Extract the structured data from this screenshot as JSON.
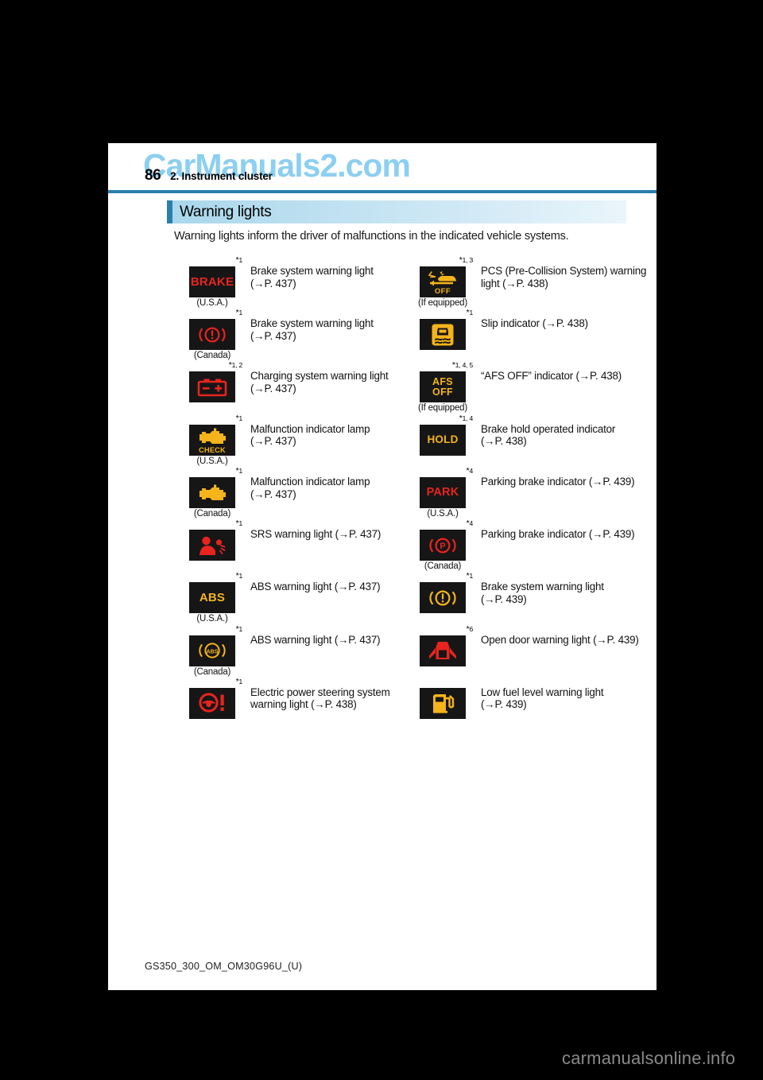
{
  "watermark": "CarManuals2.com",
  "header": {
    "page_number": "86",
    "chapter": "2. Instrument cluster"
  },
  "section": {
    "title": "Warning lights"
  },
  "intro": "Warning lights inform the driver of malfunctions in the indicated vehicle systems.",
  "footer": {
    "doc_code": "GS350_300_OM_OM30G96U_(U)"
  },
  "sitemark": "carmanualsonline.info",
  "colors": {
    "accent_blue": "#2a7fad",
    "title_band": "#a9d7ec",
    "lamp_bg": "#161616",
    "warning_red": "#e8241f",
    "warning_amber": "#f5b41b",
    "watermark_blue": "#79c7ef"
  },
  "rows": [
    {
      "left": {
        "footnote": "*1",
        "icon": "brake-text-lamp-icon",
        "lamp_text": "BRAKE",
        "region": "(U.S.A.)",
        "description": "Brake system warning light",
        "page_ref": "(→P. 437)"
      },
      "right": {
        "footnote": "*1, 3",
        "icon": "pcs-off-lamp-icon",
        "lamp_text": "OFF",
        "region": "(If equipped)",
        "description": "PCS (Pre-Collision System) warning light",
        "page_ref": "(→P. 438)"
      }
    },
    {
      "left": {
        "footnote": "*1",
        "icon": "brake-circle-red-lamp-icon",
        "lamp_text": "",
        "region": "(Canada)",
        "description": "Brake system warning light",
        "page_ref": "(→P. 437)"
      },
      "right": {
        "footnote": "*1",
        "icon": "slip-indicator-lamp-icon",
        "lamp_text": "",
        "region": "",
        "description": "Slip indicator",
        "page_ref": "(→P. 438)"
      }
    },
    {
      "left": {
        "footnote": "*1, 2",
        "icon": "battery-charging-lamp-icon",
        "lamp_text": "",
        "region": "",
        "description": "Charging system warning light",
        "page_ref": "(→P. 437)"
      },
      "right": {
        "footnote": "*1, 4, 5",
        "icon": "afs-off-lamp-icon",
        "lamp_text": "AFS OFF",
        "region": "(If equipped)",
        "description": "“AFS OFF” indicator",
        "page_ref": "(→P. 438)"
      }
    },
    {
      "left": {
        "footnote": "*1",
        "icon": "check-engine-check-lamp-icon",
        "lamp_text": "CHECK",
        "region": "(U.S.A.)",
        "description": "Malfunction indicator lamp",
        "page_ref": "(→P. 437)"
      },
      "right": {
        "footnote": "*1, 4",
        "icon": "brake-hold-lamp-icon",
        "lamp_text": "HOLD",
        "region": "",
        "description": "Brake hold operated indicator",
        "page_ref": "(→P. 438)"
      }
    },
    {
      "left": {
        "footnote": "*1",
        "icon": "check-engine-lamp-icon",
        "lamp_text": "",
        "region": "(Canada)",
        "description": "Malfunction indicator lamp",
        "page_ref": "(→P. 437)"
      },
      "right": {
        "footnote": "*4",
        "icon": "park-text-lamp-icon",
        "lamp_text": "PARK",
        "region": "(U.S.A.)",
        "description": "Parking brake indicator",
        "page_ref": "(→P. 439)"
      }
    },
    {
      "left": {
        "footnote": "*1",
        "icon": "srs-airbag-lamp-icon",
        "lamp_text": "",
        "region": "",
        "description": "SRS warning light",
        "page_ref": "(→P. 437)"
      },
      "right": {
        "footnote": "*4",
        "icon": "parking-brake-p-lamp-icon",
        "lamp_text": "",
        "region": "(Canada)",
        "description": "Parking brake indicator",
        "page_ref": "(→P. 439)"
      }
    },
    {
      "left": {
        "footnote": "*1",
        "icon": "abs-text-lamp-icon",
        "lamp_text": "ABS",
        "region": "(U.S.A.)",
        "description": "ABS warning light",
        "page_ref": "(→P. 437)"
      },
      "right": {
        "footnote": "*1",
        "icon": "brake-circle-amber-lamp-icon",
        "lamp_text": "",
        "region": "",
        "description": "Brake system warning light",
        "page_ref": "(→P. 439)"
      }
    },
    {
      "left": {
        "footnote": "*1",
        "icon": "abs-circle-lamp-icon",
        "lamp_text": "",
        "region": "(Canada)",
        "description": "ABS warning light",
        "page_ref": "(→P. 437)"
      },
      "right": {
        "footnote": "*6",
        "icon": "open-door-lamp-icon",
        "lamp_text": "",
        "region": "",
        "description": "Open door warning light",
        "page_ref": "(→P. 439)"
      }
    },
    {
      "left": {
        "footnote": "*1",
        "icon": "electric-power-steering-lamp-icon",
        "lamp_text": "",
        "region": "",
        "description": "Electric power steering system warning light",
        "page_ref": "(→P. 438)"
      },
      "right": {
        "footnote": "",
        "icon": "low-fuel-lamp-icon",
        "lamp_text": "",
        "region": "",
        "description": "Low fuel level warning light",
        "page_ref": "(→P. 439)"
      }
    }
  ]
}
